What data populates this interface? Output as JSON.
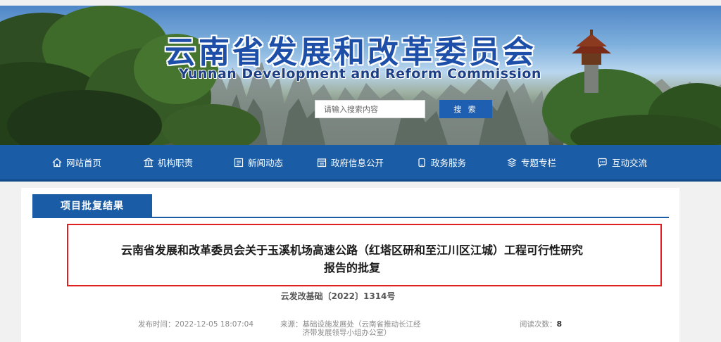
{
  "header": {
    "title": "云南省发展和改革委员会",
    "subtitle": "Yunnan Development and Reform Commission"
  },
  "search": {
    "placeholder": "请输入搜索内容",
    "button_label": "搜 索"
  },
  "nav": {
    "items": [
      {
        "label": "网站首页",
        "icon": "home-icon"
      },
      {
        "label": "机构职责",
        "icon": "institution-icon"
      },
      {
        "label": "新闻动态",
        "icon": "news-icon"
      },
      {
        "label": "政府信息公开",
        "icon": "info-disclosure-icon"
      },
      {
        "label": "政务服务",
        "icon": "service-icon"
      },
      {
        "label": "专题专栏",
        "icon": "topics-icon"
      },
      {
        "label": "互动交流",
        "icon": "chat-icon"
      }
    ]
  },
  "section": {
    "tab_label": "项目批复结果"
  },
  "article": {
    "title_line1": "云南省发展和改革委员会关于玉溪机场高速公路（红塔区研和至江川区江城）工程可行性研究",
    "title_line2": "报告的批复",
    "doc_number": "云发改基础〔2022〕1314号",
    "meta": {
      "publish_label": "发布时间：",
      "publish_time": "2022-12-05 18:07:04",
      "source_label": "来源：",
      "source_line1": "基础设施发展处（云南省推动长江经",
      "source_line2": "济带发展领导小组办公室）",
      "views_label": "阅读次数：",
      "views": "8"
    }
  },
  "colors": {
    "nav_blue": "#1a5da6",
    "title_blue": "#1d4fa8",
    "highlight_red": "#e02020"
  }
}
